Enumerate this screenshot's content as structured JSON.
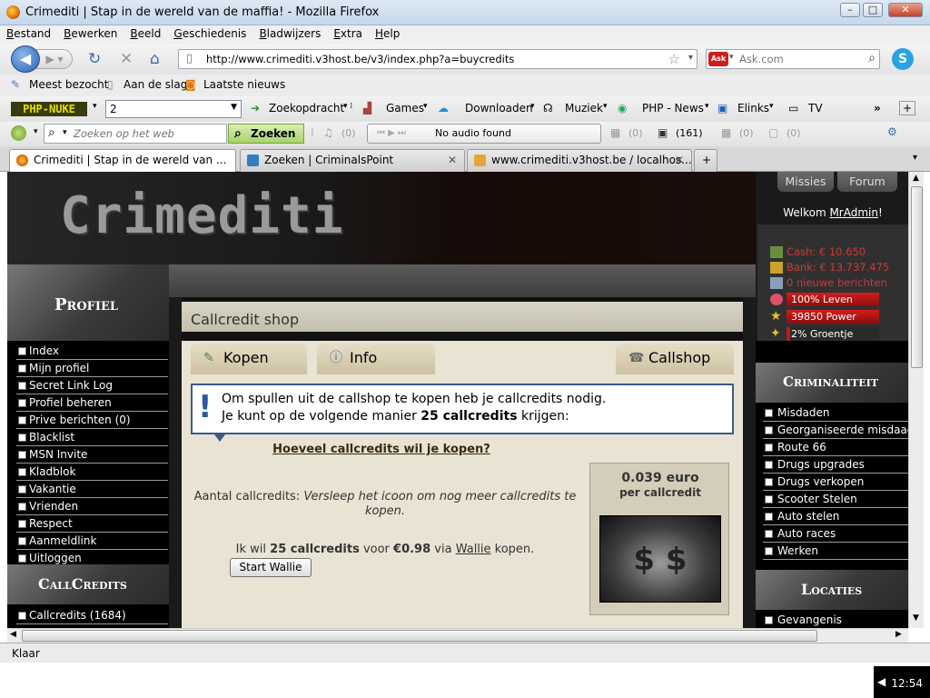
{
  "window": {
    "title": "Crimediti | Stap in de wereld van de maffia! - Mozilla Firefox"
  },
  "menu": [
    "Bestand",
    "Bewerken",
    "Beeld",
    "Geschiedenis",
    "Bladwijzers",
    "Extra",
    "Help"
  ],
  "nav": {
    "url": "http://www.crimediti.v3host.be/v3/index.php?a=buycredits",
    "search_placeholder": "Ask.com",
    "search_engine": "Ask"
  },
  "bookmarks": [
    "Meest bezocht",
    "Aan de slag",
    "Laatste nieuws"
  ],
  "toolbar1": {
    "logo": "PHP-NUKE",
    "select_value": "2",
    "items": [
      "Zoekopdracht",
      "Games",
      "Downloaden",
      "Muziek",
      "PHP - News",
      "Elinks",
      "TV"
    ]
  },
  "toolbar2": {
    "search_placeholder": "Zoeken op het web",
    "search_button": "Zoeken",
    "vol": "(0)",
    "audio": "No audio found",
    "c1": "(0)",
    "c2": "(161)",
    "c3": "(0)",
    "c4": "(0)"
  },
  "tabs": [
    {
      "label": "Crimediti | Stap in de wereld van ..."
    },
    {
      "label": "Zoeken | CriminalsPoint"
    },
    {
      "label": "www.crimediti.v3host.be / localhos..."
    }
  ],
  "site": {
    "logo": "Crimediti",
    "top_tabs": [
      "Missies",
      "Forum"
    ],
    "welcome_prefix": "Welkom ",
    "welcome_user": "MrAdmin",
    "welcome_suffix": "!",
    "stats": {
      "cash": "Cash: € 10.650",
      "bank": "Bank: € 13.737.475",
      "messages": "0 nieuwe berichten",
      "leven": "100% Leven",
      "power": "39850 Power",
      "groentje": "2% Groentje"
    },
    "left_sections": [
      {
        "title": "Profiel",
        "items": [
          "Index",
          "Mijn profiel",
          "Secret Link Log",
          "Profiel beheren",
          "Prive berichten (0)",
          "Blacklist",
          "MSN Invite",
          "Kladblok",
          "Vakantie",
          "Vrienden",
          "Respect",
          "Aanmeldlink",
          "Uitloggen"
        ]
      },
      {
        "title": "CallCredits",
        "items": [
          "Callcredits (1684)"
        ]
      }
    ],
    "right_sections": [
      {
        "title": "Criminaliteit",
        "items": [
          "Misdaden",
          "Georganiseerde misdaad",
          "Route 66",
          "Drugs upgrades",
          "Drugs verkopen",
          "Scooter Stelen",
          "Auto stelen",
          "Auto races",
          "Werken"
        ]
      },
      {
        "title": "Locaties",
        "items": [
          "Gevangenis"
        ]
      }
    ],
    "shop": {
      "title": "Callcredit shop",
      "tabs": [
        "Kopen",
        "Info",
        "Callshop"
      ],
      "info_line1": "Om spullen uit de callshop te kopen heb je callcredits nodig.",
      "info_line2_prefix": "Je kunt op de volgende manier ",
      "info_line2_bold": "25 callcredits",
      "info_line2_suffix": " krijgen:",
      "question": "Hoeveel callcredits wil je kopen?",
      "aantal_label": "Aantal callcredits: ",
      "aantal_hint": "Versleep het icoon om nog meer callcredits te kopen.",
      "ikwil_prefix": "Ik wil ",
      "ikwil_credits": "25 callcredits",
      "ikwil_voor": " voor ",
      "ikwil_price": "€0.98",
      "ikwil_via": " via ",
      "ikwil_provider": "Wallie",
      "ikwil_suffix": " kopen.",
      "start_button": "Start Wallie",
      "price_value": "0.039 euro",
      "price_unit": "per callcredit"
    }
  },
  "status": "Klaar",
  "clock": "12:54"
}
